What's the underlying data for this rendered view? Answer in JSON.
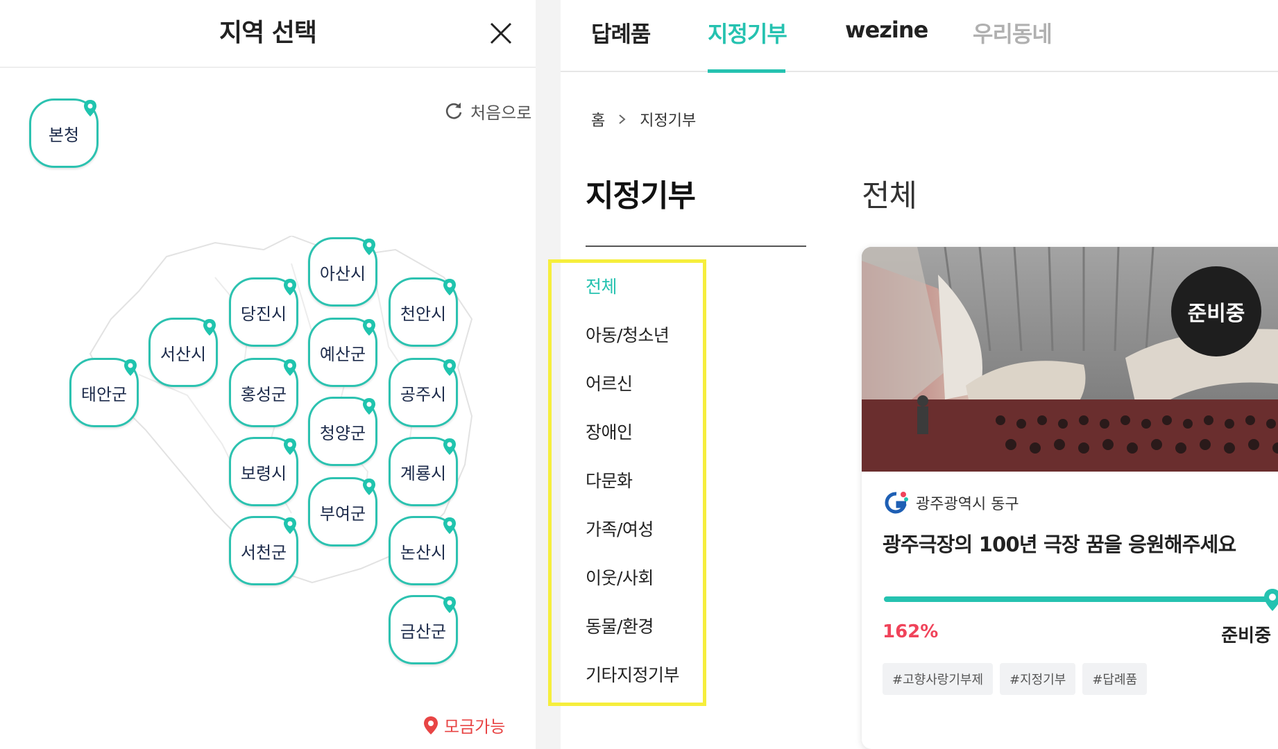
{
  "colors": {
    "accent": "#25c2b0",
    "region_border": "#2cc2b0",
    "percent": "#f0435a",
    "legend": "#e84545",
    "highlight": "#f6ee3c"
  },
  "region_modal": {
    "title": "지역 선택",
    "reset_label": "처음으로",
    "hq": {
      "label": "본청"
    },
    "regions": [
      "아산시",
      "당진시",
      "천안시",
      "서산시",
      "예산군",
      "태안군",
      "홍성군",
      "공주시",
      "청양군",
      "보령시",
      "계룡시",
      "부여군",
      "서천군",
      "논산시",
      "금산군"
    ],
    "legend_label": "모금가능",
    "icons": {
      "close": "close-icon",
      "reset": "refresh-icon",
      "pin": "map-pin-icon"
    }
  },
  "nav": {
    "tabs": [
      {
        "label": "답례품",
        "active": false
      },
      {
        "label": "지정기부",
        "active": true
      },
      {
        "label": "wezine",
        "active": false
      },
      {
        "label": "우리동네",
        "active": false
      }
    ]
  },
  "breadcrumb": {
    "home": "홈",
    "current": "지정기부"
  },
  "sidebar": {
    "title": "지정기부",
    "categories": [
      "전체",
      "아동/청소년",
      "어르신",
      "장애인",
      "다문화",
      "가족/여성",
      "이웃/사회",
      "동물/환경",
      "기타지정기부"
    ],
    "active_index": 0
  },
  "content": {
    "title": "전체",
    "card": {
      "status_badge": "준비중",
      "org": "광주광역시 동구",
      "title": "광주극장의 100년 극장 꿈을 응원해주세요",
      "progress": {
        "percent_label": "162%",
        "fill_fraction": 1.0,
        "status": "준비중"
      },
      "tags": [
        "#고향사랑기부제",
        "#지정기부",
        "#답례품"
      ]
    }
  }
}
